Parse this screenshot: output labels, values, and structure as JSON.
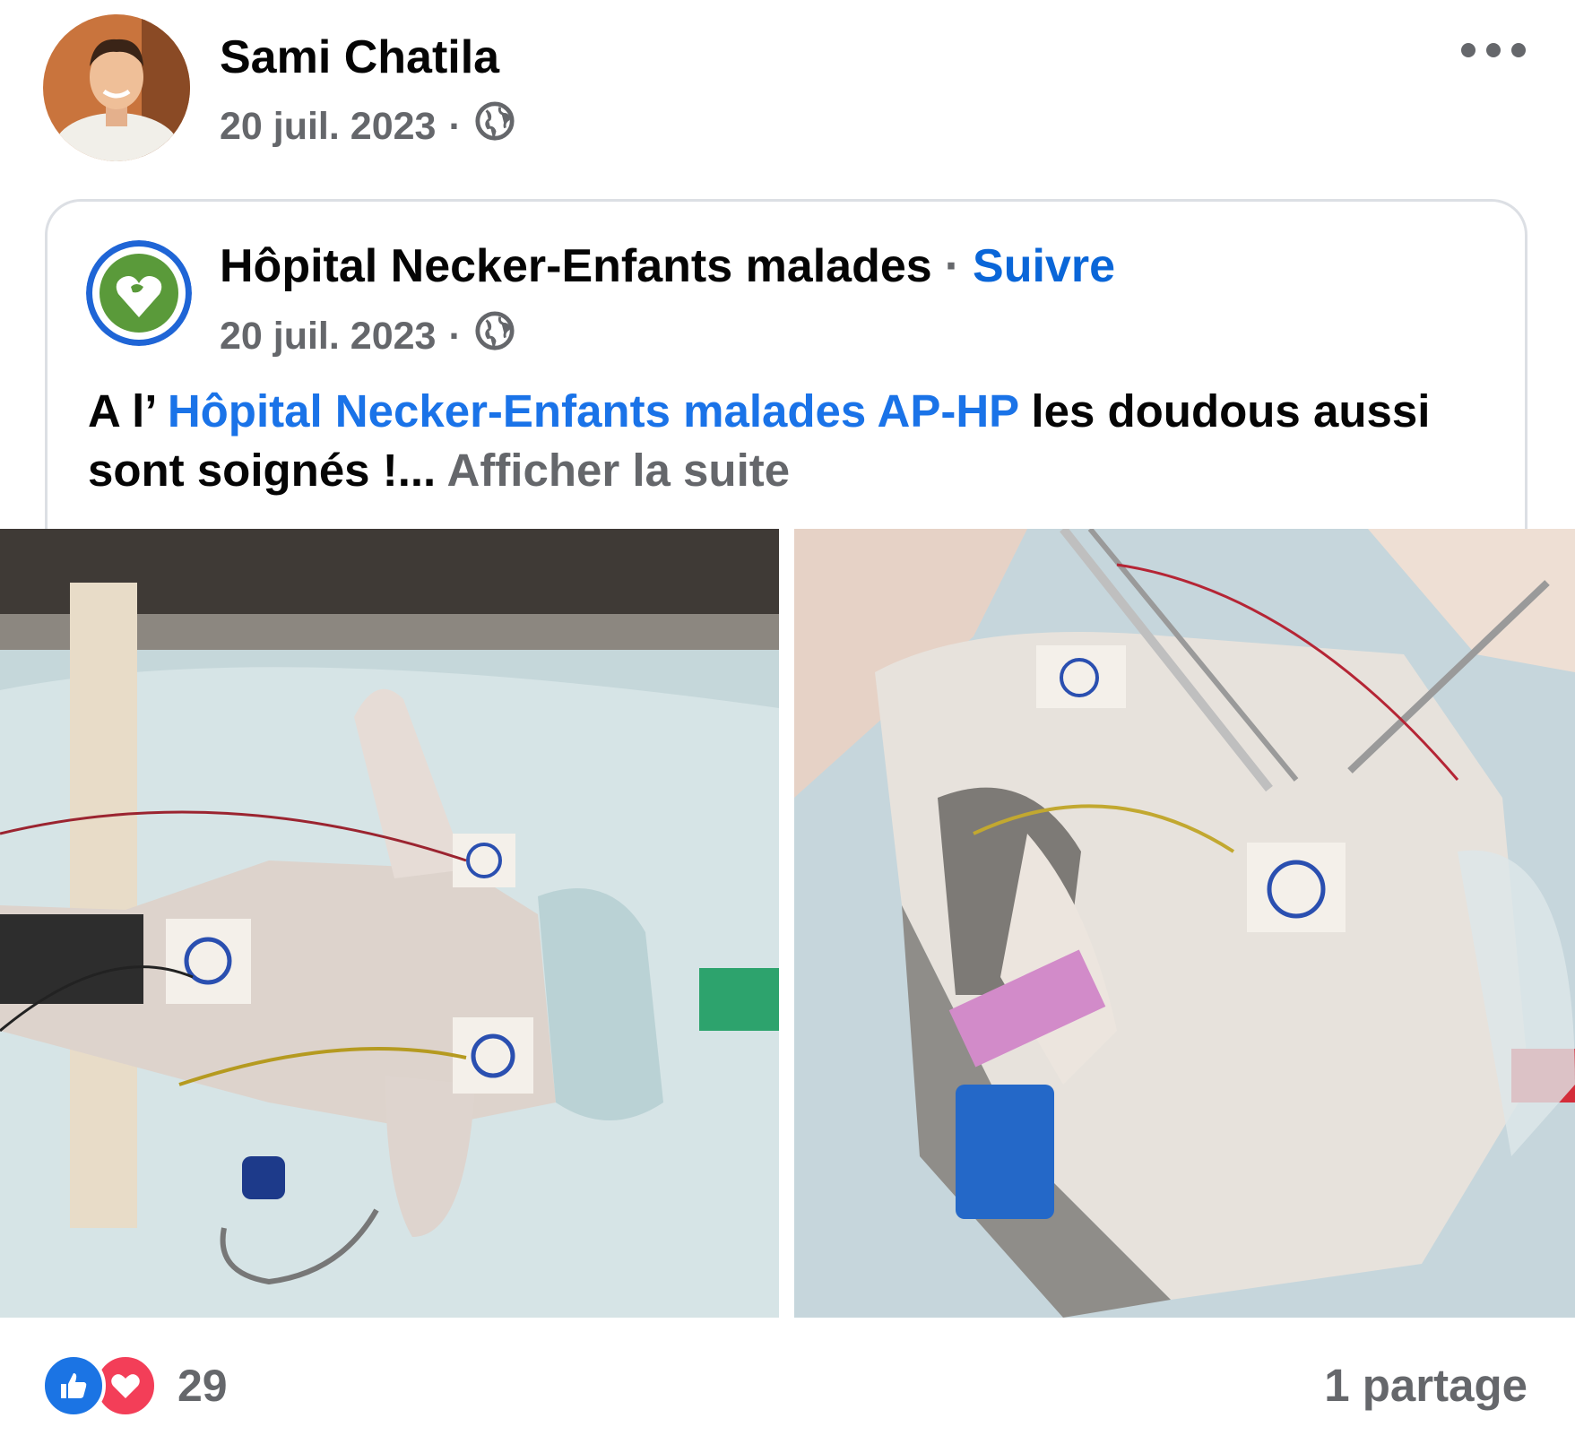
{
  "post": {
    "author": "Sami Chatila",
    "date": "20 juil. 2023",
    "separator": "·",
    "audience_icon": "globe-icon",
    "menu_icon": "more-options-icon"
  },
  "shared": {
    "page_name": "Hôpital Necker-Enfants malades",
    "separator": "·",
    "follow_label": "Suivre",
    "date": "20 juil. 2023",
    "text_prefix": "A l’ ",
    "text_link": "Hôpital Necker-Enfants malades AP-HP",
    "text_suffix": " les doudous aussi sont soignés !... ",
    "see_more": "Afficher la suite"
  },
  "photos": [
    {
      "subject": "stuffed toy with oxygen mask and monitoring electrodes"
    },
    {
      "subject": "stuffed toy receiving stitches with forceps"
    }
  ],
  "footer": {
    "reaction_icons": [
      "like-icon",
      "love-icon"
    ],
    "reaction_count": "29",
    "shares": "1 partage"
  },
  "colors": {
    "link": "#1a73e8",
    "follow": "#0a66d8",
    "secondary_text": "#65676b",
    "like": "#1b74e4",
    "love": "#f33e58"
  }
}
